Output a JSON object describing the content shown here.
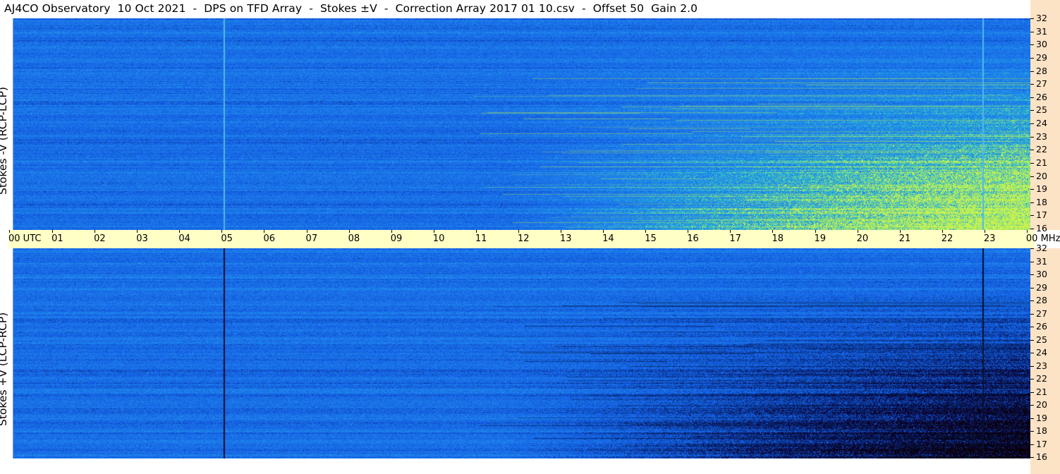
{
  "title": "AJ4CO Observatory  10 Oct 2021  -  DPS on TFD Array  -  Stokes ±V  -  Correction Array 2017 01 10.csv  -  Offset 50  Gain 2.0",
  "panels": [
    {
      "id": "top",
      "label": "Stokes -V (RCP-LCP)"
    },
    {
      "id": "bottom",
      "label": "Stokes +V (LCP-RCP)"
    }
  ],
  "freq_axis": {
    "unit": "MHz",
    "ticks": [
      "32",
      "31",
      "30",
      "29",
      "28",
      "27",
      "26",
      "25",
      "24",
      "23",
      "22",
      "21",
      "20",
      "19",
      "18",
      "17",
      "16"
    ]
  },
  "time_axis": {
    "start_label": "00 UTC",
    "ticks": [
      "01",
      "02",
      "03",
      "04",
      "05",
      "06",
      "07",
      "08",
      "09",
      "10",
      "11",
      "12",
      "13",
      "14",
      "15",
      "16",
      "17",
      "18",
      "19",
      "20",
      "21",
      "22",
      "23"
    ],
    "end_label": "00 MHz"
  },
  "colors": {
    "background_blue": "#1f66e6",
    "scale_bg": "#fde3c6",
    "time_bar_bg": "#ffffc6"
  }
}
